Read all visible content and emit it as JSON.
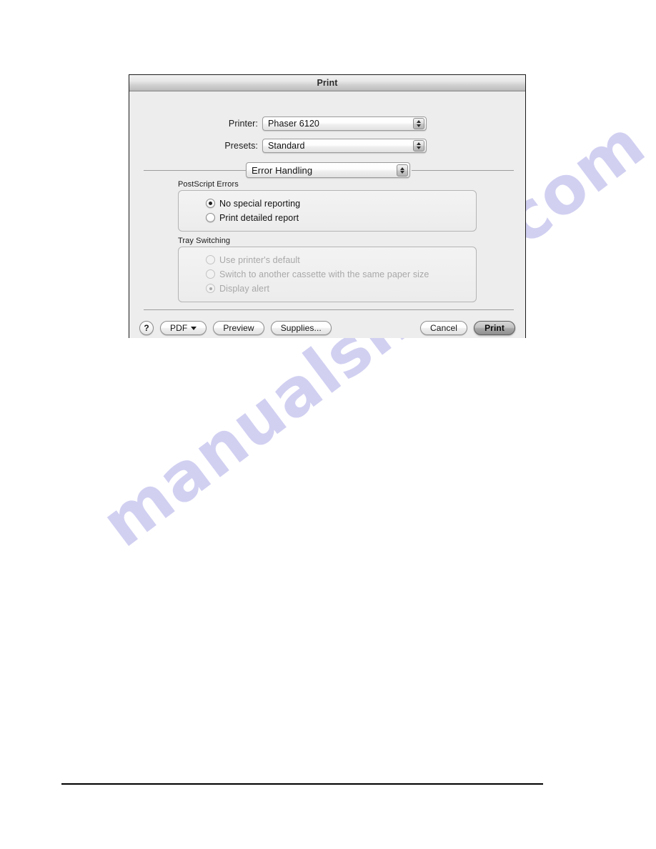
{
  "page": {
    "watermark_text": "manualshive.com"
  },
  "dialog": {
    "title": "Print",
    "fields": [
      {
        "label": "Printer:",
        "value": "Phaser 6120"
      },
      {
        "label": "Presets:",
        "value": "Standard"
      }
    ],
    "pane_popup": {
      "value": "Error Handling"
    },
    "groups": [
      {
        "label": "PostScript Errors",
        "disabled": false,
        "options": [
          {
            "label": "No special reporting",
            "selected": true
          },
          {
            "label": "Print detailed report",
            "selected": false
          }
        ]
      },
      {
        "label": "Tray Switching",
        "disabled": true,
        "options": [
          {
            "label": "Use printer's default",
            "selected": false
          },
          {
            "label": "Switch to another cassette with the same paper size",
            "selected": false
          },
          {
            "label": "Display alert",
            "selected": true
          }
        ]
      }
    ],
    "buttons": {
      "help": "?",
      "pdf": "PDF",
      "preview": "Preview",
      "supplies": "Supplies...",
      "cancel": "Cancel",
      "print": "Print"
    }
  }
}
